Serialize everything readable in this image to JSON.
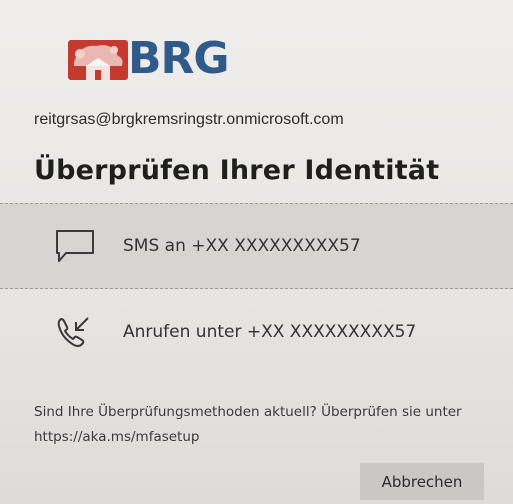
{
  "logo": {
    "text": "BRG",
    "text_color": "#2f5a8a",
    "mark_color": "#c43a2e",
    "mark_icon": "tree-house-emblem-icon"
  },
  "account": {
    "email": "reitgrsas@brgkremsringstr.onmicrosoft.com"
  },
  "page": {
    "title": "Überprüfen Ihrer Identität"
  },
  "options": [
    {
      "id": "sms",
      "icon": "chat-bubble-icon",
      "label": "SMS an +XX XXXXXXXXX57",
      "highlighted": true
    },
    {
      "id": "call",
      "icon": "phone-call-icon",
      "label": "Anrufen unter +XX XXXXXXXXX57",
      "highlighted": false
    }
  ],
  "info": {
    "text": "Sind Ihre Überprüfungsmethoden aktuell? Überprüfen sie unter https://aka.ms/mfasetup"
  },
  "actions": {
    "cancel_label": "Abbrechen"
  }
}
